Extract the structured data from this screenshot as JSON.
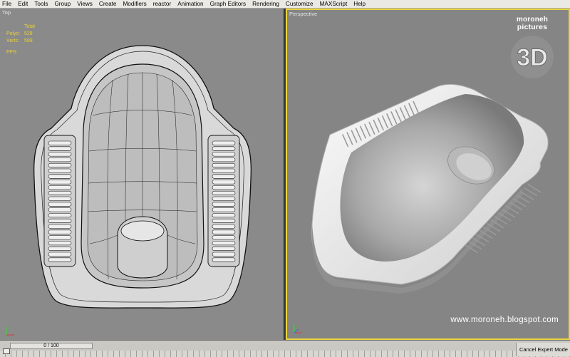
{
  "menu": {
    "items": [
      "File",
      "Edit",
      "Tools",
      "Group",
      "Views",
      "Create",
      "Modifiers",
      "reactor",
      "Animation",
      "Graph Editors",
      "Rendering",
      "Customize",
      "MAXScript",
      "Help"
    ]
  },
  "viewports": {
    "top": {
      "label": "Top",
      "stats": {
        "total_label": "Total",
        "polys_label": "Polys:",
        "polys_value": "528",
        "verts_label": "Verts:",
        "verts_value": "599",
        "fps_label": "FPS:"
      }
    },
    "perspective": {
      "label": "Perspective",
      "watermark_url": "www.moroneh.blogspot.com",
      "logo": {
        "line1": "moroneh",
        "line2": "pictures",
        "mark": "3D"
      }
    }
  },
  "timeline": {
    "frame_display": "0 / 100",
    "cancel_button": "Cancel Expert Mode"
  },
  "colors": {
    "active_viewport_border": "#e8d43c",
    "stats_text": "#e8d03c",
    "viewport_bg": "#8a8a8a"
  }
}
